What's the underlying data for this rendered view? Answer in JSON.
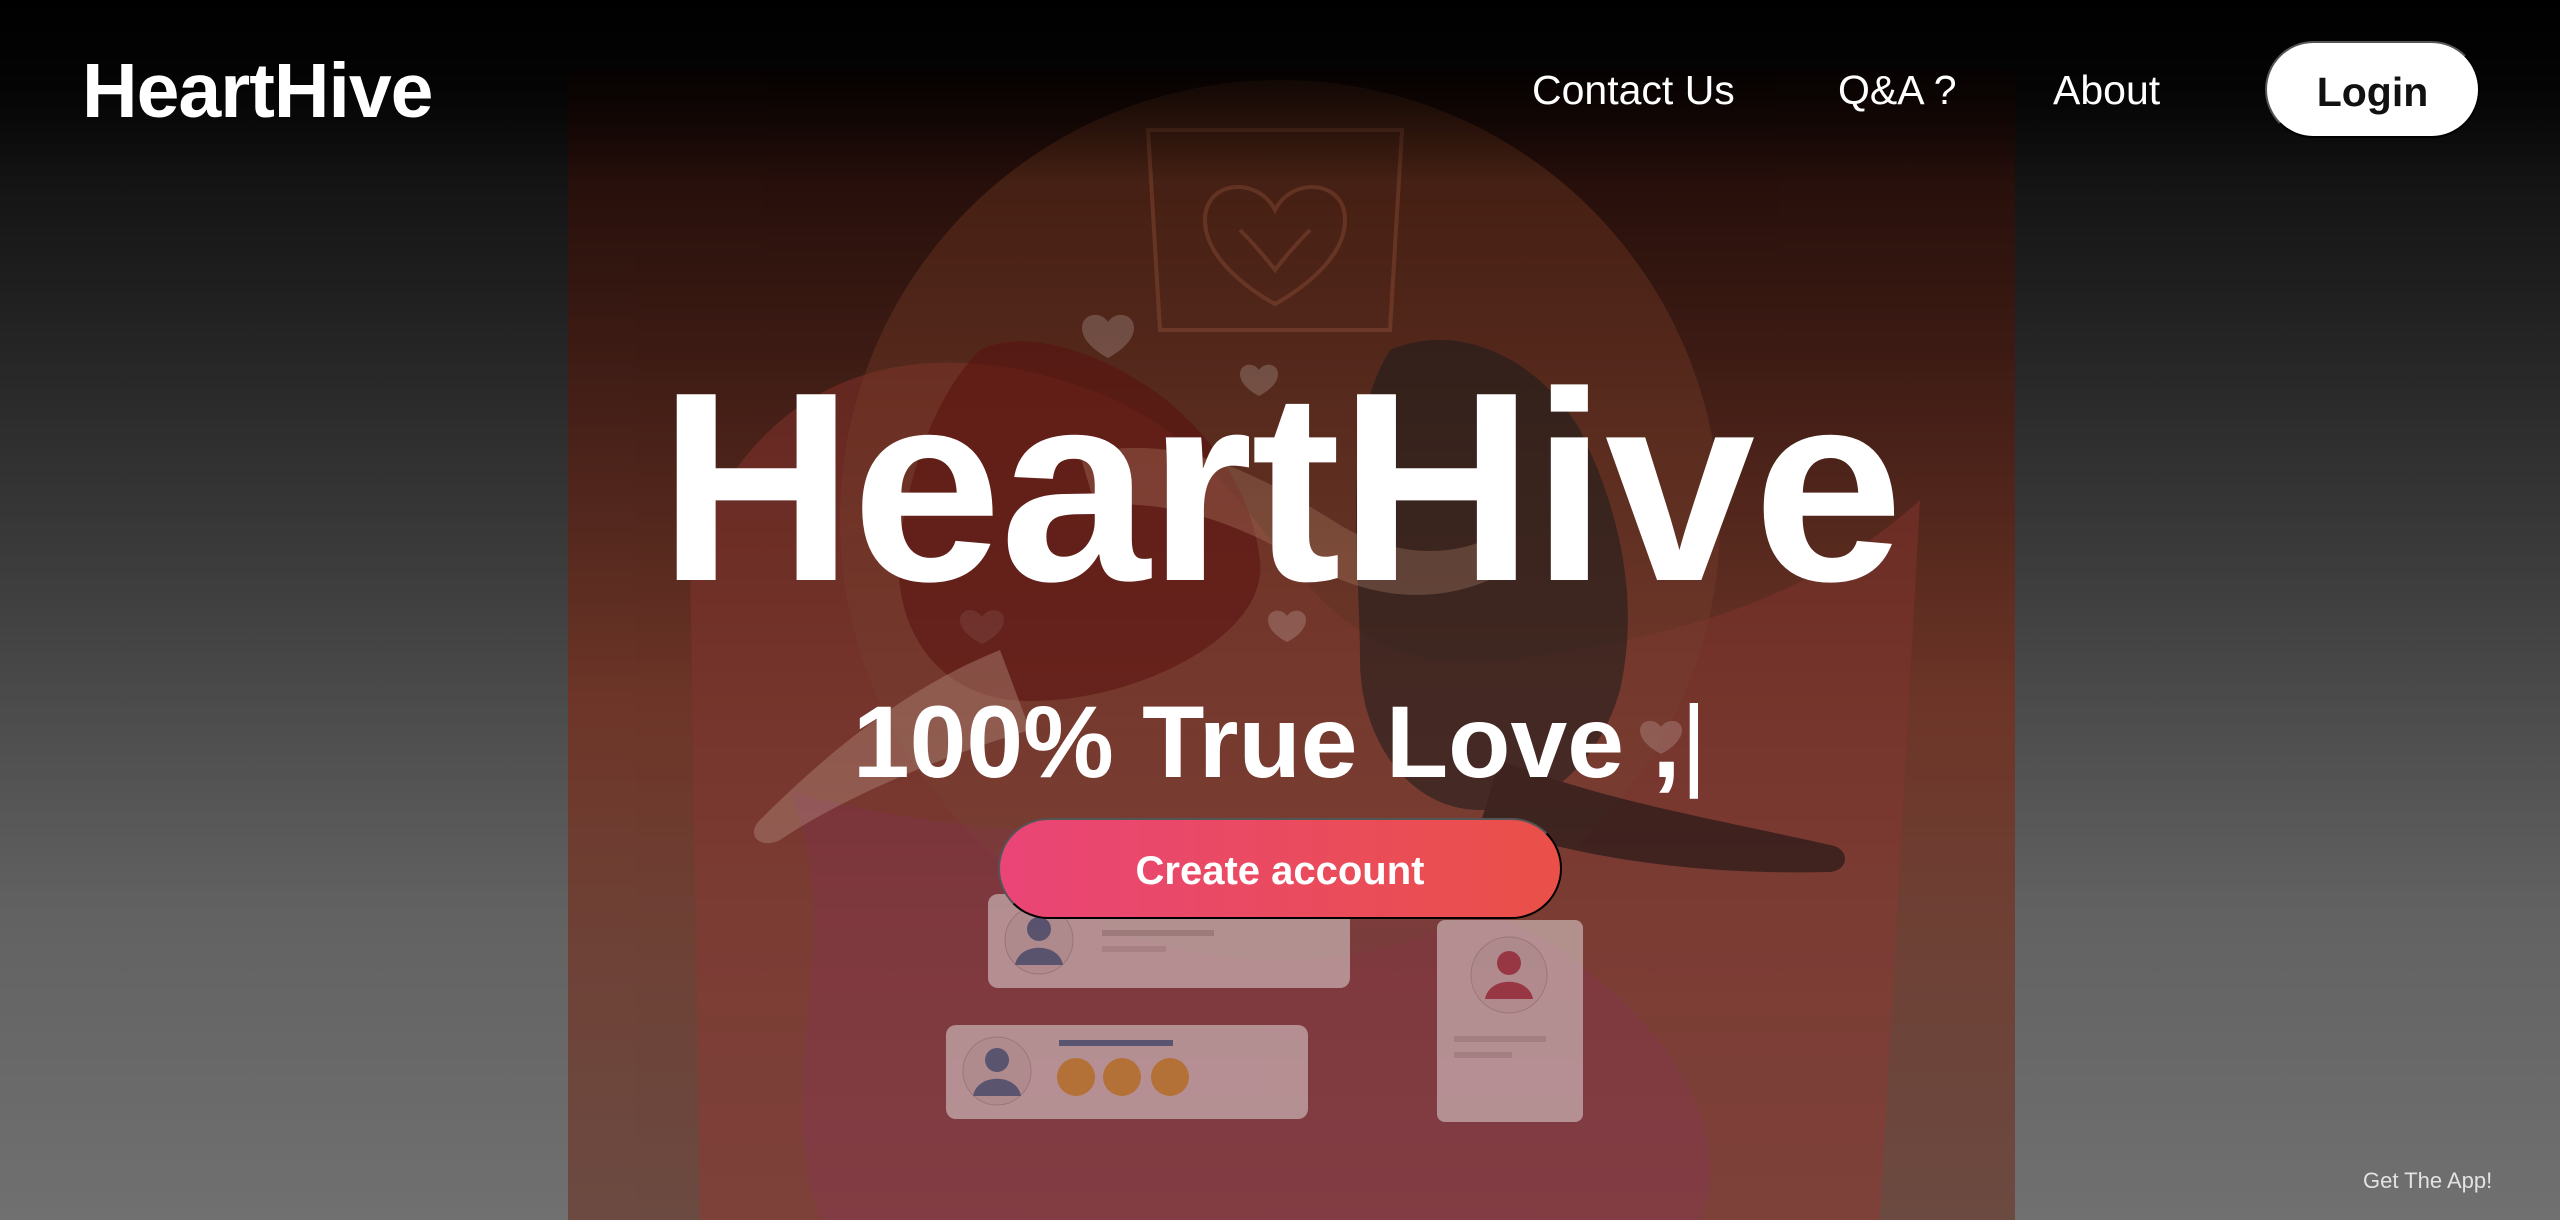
{
  "header": {
    "brand": "HeartHive",
    "nav": {
      "contact": "Contact Us",
      "qa": "Q&A ?",
      "about": "About"
    },
    "login": "Login"
  },
  "hero": {
    "title": "HeartHive",
    "subtitle": "100% True Love ,",
    "cursor": "|",
    "create_account": "Create account"
  },
  "footer": {
    "get_app": "Get The App!"
  },
  "colors": {
    "button_gradient_start": "#ea4577",
    "button_gradient_end": "#ea5048",
    "login_background": "#ffffff",
    "illustration_accent": "#e45a3f"
  },
  "icons": {
    "hero_illustration": "couple-hearts-chat-illustration"
  }
}
